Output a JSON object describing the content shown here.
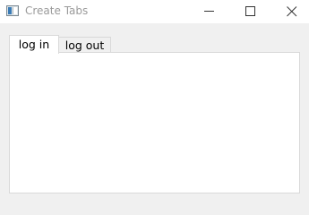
{
  "window": {
    "title": "Create Tabs",
    "icons": {
      "app": "app-window-icon",
      "minimize": "minimize-icon",
      "maximize": "maximize-icon",
      "close": "close-icon"
    }
  },
  "tabs": [
    {
      "label": "log in",
      "selected": true
    },
    {
      "label": "log out",
      "selected": false
    }
  ]
}
